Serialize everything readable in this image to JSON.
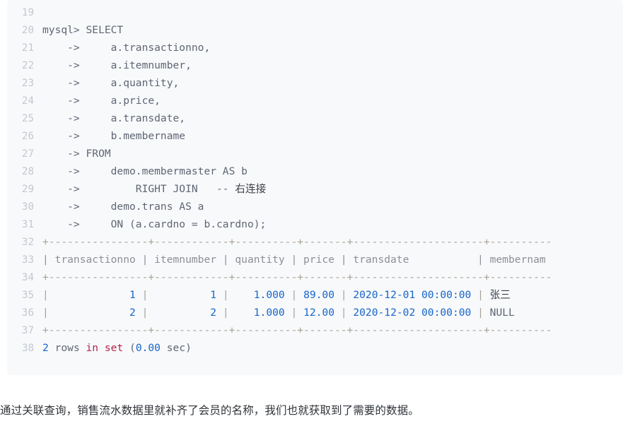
{
  "code_block": {
    "language": "sql-console",
    "background_color": "#f8f9fb",
    "line_number_color": "#c2c8cf",
    "first_line_number": 19,
    "colors": {
      "plain": "#5f6673",
      "number": "#1565c9",
      "keyword": "#b3234a",
      "rule": "#a9a394",
      "header": "#8d8f96",
      "cjk": "#3b3f46"
    },
    "lines": [
      {
        "number": "19",
        "tokens": []
      },
      {
        "number": "20",
        "tokens": [
          {
            "t": "mysql> SELECT",
            "c": "plain"
          }
        ]
      },
      {
        "number": "21",
        "tokens": [
          {
            "t": "    ->     a.transactionno,",
            "c": "plain"
          }
        ]
      },
      {
        "number": "22",
        "tokens": [
          {
            "t": "    ->     a.itemnumber,",
            "c": "plain"
          }
        ]
      },
      {
        "number": "23",
        "tokens": [
          {
            "t": "    ->     a.quantity,",
            "c": "plain"
          }
        ]
      },
      {
        "number": "24",
        "tokens": [
          {
            "t": "    ->     a.price,",
            "c": "plain"
          }
        ]
      },
      {
        "number": "25",
        "tokens": [
          {
            "t": "    ->     a.transdate,",
            "c": "plain"
          }
        ]
      },
      {
        "number": "26",
        "tokens": [
          {
            "t": "    ->     b.membername",
            "c": "plain"
          }
        ]
      },
      {
        "number": "27",
        "tokens": [
          {
            "t": "    -> FROM",
            "c": "plain"
          }
        ]
      },
      {
        "number": "28",
        "tokens": [
          {
            "t": "    ->     demo.membermaster AS b",
            "c": "plain"
          }
        ]
      },
      {
        "number": "29",
        "tokens": [
          {
            "t": "    ->         RIGHT JOIN   -- ",
            "c": "plain"
          },
          {
            "t": "右连接",
            "c": "cjk"
          }
        ]
      },
      {
        "number": "30",
        "tokens": [
          {
            "t": "    ->     demo.trans AS a",
            "c": "plain"
          }
        ]
      },
      {
        "number": "31",
        "tokens": [
          {
            "t": "    ->     ON (a.cardno = b.cardno);",
            "c": "plain"
          }
        ]
      },
      {
        "number": "32",
        "tokens": [
          {
            "t": "+----------------+------------+----------+-------+---------------------+----------",
            "c": "rule"
          }
        ]
      },
      {
        "number": "33",
        "tokens": [
          {
            "t": "| transactionno | itemnumber | quantity | price | transdate           | membernam",
            "c": "header"
          }
        ]
      },
      {
        "number": "34",
        "tokens": [
          {
            "t": "+----------------+------------+----------+-------+---------------------+----------",
            "c": "rule"
          }
        ]
      },
      {
        "number": "35",
        "tokens": [
          {
            "t": "|",
            "c": "rule"
          },
          {
            "t": "             1",
            "c": "number"
          },
          {
            "t": " |",
            "c": "rule"
          },
          {
            "t": "          1",
            "c": "number"
          },
          {
            "t": " |",
            "c": "rule"
          },
          {
            "t": "    1.000",
            "c": "number"
          },
          {
            "t": " |",
            "c": "rule"
          },
          {
            "t": " 89.00",
            "c": "number"
          },
          {
            "t": " |",
            "c": "rule"
          },
          {
            "t": " 2020-12-01 00:00:00",
            "c": "number"
          },
          {
            "t": " |",
            "c": "rule"
          },
          {
            "t": " 张三",
            "c": "cjk"
          }
        ]
      },
      {
        "number": "36",
        "tokens": [
          {
            "t": "|",
            "c": "rule"
          },
          {
            "t": "             2",
            "c": "number"
          },
          {
            "t": " |",
            "c": "rule"
          },
          {
            "t": "          2",
            "c": "number"
          },
          {
            "t": " |",
            "c": "rule"
          },
          {
            "t": "    1.000",
            "c": "number"
          },
          {
            "t": " |",
            "c": "rule"
          },
          {
            "t": " 12.00",
            "c": "number"
          },
          {
            "t": " |",
            "c": "rule"
          },
          {
            "t": " 2020-12-02 00:00:00",
            "c": "number"
          },
          {
            "t": " |",
            "c": "rule"
          },
          {
            "t": " NULL",
            "c": "plain"
          }
        ]
      },
      {
        "number": "37",
        "tokens": [
          {
            "t": "+----------------+------------+----------+-------+---------------------+----------",
            "c": "rule"
          }
        ]
      },
      {
        "number": "38",
        "tokens": [
          {
            "t": "2",
            "c": "number"
          },
          {
            "t": " rows ",
            "c": "plain"
          },
          {
            "t": "in set",
            "c": "keyword"
          },
          {
            "t": " (",
            "c": "plain"
          },
          {
            "t": "0.00",
            "c": "number"
          },
          {
            "t": " sec)",
            "c": "plain"
          }
        ]
      }
    ],
    "result_table": {
      "columns": [
        "transactionno",
        "itemnumber",
        "quantity",
        "price",
        "transdate",
        "membername"
      ],
      "rows": [
        [
          "1",
          "1",
          "1.000",
          "89.00",
          "2020-12-01 00:00:00",
          "张三"
        ],
        [
          "2",
          "2",
          "1.000",
          "12.00",
          "2020-12-02 00:00:00",
          "NULL"
        ]
      ],
      "footer": "2 rows in set (0.00 sec)"
    }
  },
  "paragraph": {
    "text": "通过关联查询，销售流水数据里就补齐了会员的名称，我们也就获取到了需要的数据。"
  }
}
